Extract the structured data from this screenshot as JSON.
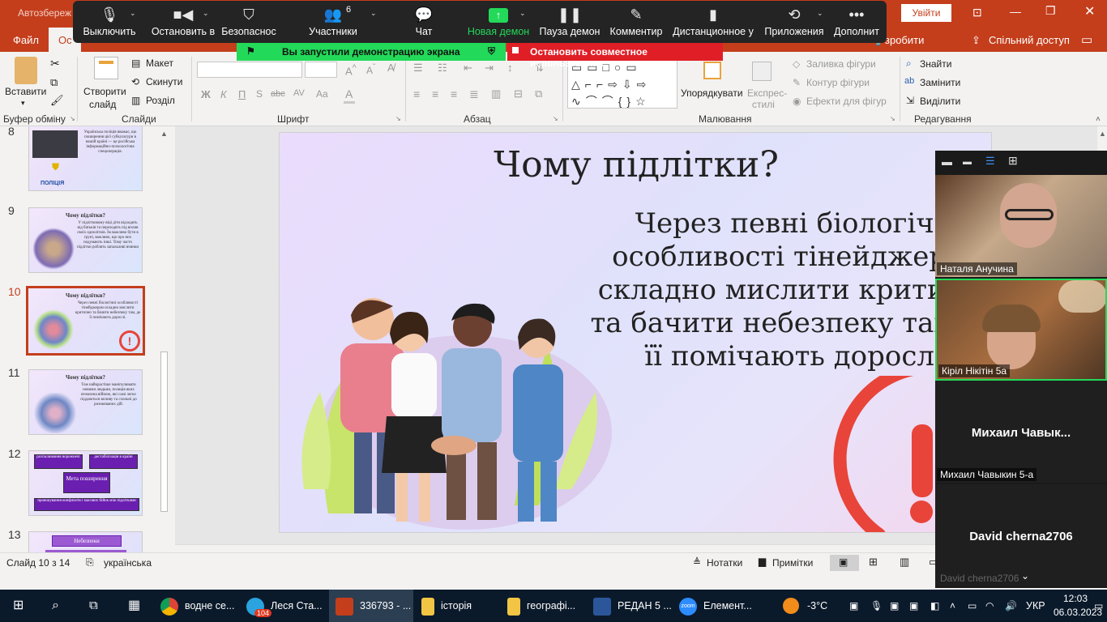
{
  "window": {
    "title": "Автозбереж",
    "signin_label": "Увійти",
    "min_icon": "minimize-icon",
    "max_icon": "restore-icon",
    "close_icon": "close-icon"
  },
  "ribbon_tabs": {
    "file": "Файл",
    "home": "Ос",
    "tell": "зробити",
    "share": "Спільний доступ"
  },
  "zoom": {
    "mute": "Выключить",
    "video": "Остановить в",
    "security": "Безопаснос",
    "participants": "Участники",
    "participants_count": "6",
    "chat": "Чат",
    "share": "Новая демон",
    "pause": "Пауза демон",
    "annotate": "Комментир",
    "remote": "Дистанционное у",
    "apps": "Приложения",
    "more": "Дополнит",
    "sharing_notice": "Вы запустили демонстрацию экрана",
    "stop_share": "Остановить совместное использование"
  },
  "ribbon": {
    "paste": "Вставити",
    "new_slide": "Створити",
    "new_slide2": "слайд",
    "layout": "Макет",
    "reset": "Скинути",
    "section": "Розділ",
    "font_bold": "Ж",
    "font_italic": "К",
    "font_underline": "П",
    "font_strike": "abc",
    "font_spacing": "AV",
    "font_case": "Aa",
    "arrange": "Упорядкувати",
    "quick_styles": "Експрес-",
    "quick_styles2": "стилі",
    "fill": "Заливка фігури",
    "outline": "Контур фігури",
    "effects": "Ефекти для фігур",
    "find": "Знайти",
    "replace": "Замінити",
    "select": "Виділити",
    "groups": {
      "clipboard": "Буфер обміну",
      "slides": "Слайди",
      "font": "Шрифт",
      "paragraph": "Абзац",
      "drawing": "Малювання",
      "editing": "Редагування"
    }
  },
  "thumbs": [
    {
      "num": "8",
      "title": "",
      "text": "Українська поліція вважає, що поширення цієї субкультури в нашій країні — це російська інформаційно-психологічна спецоперація.",
      "badge": "ПОЛІЦІЯ"
    },
    {
      "num": "9",
      "title": "Чому підлітки?",
      "text": "У підлітковому віці діти відходять від батьків та переходять під вплив своїх однолітків. Їм важливо бути в групі, важливо, що про них подумають інші. Тому часто підлітки роблять запальливі вчинки"
    },
    {
      "num": "10",
      "title": "Чому підлітки?",
      "text": "Через певні біологічні особливості тінейджерам складно мислити критично та бачити небезпеку там, де її помічають дорослі."
    },
    {
      "num": "11",
      "title": "Чому підлітки?",
      "text": "Тож найкрастіше маніпулювати новими людьми, позиція яких втомлена війною, які самі легко піддаються впливу та схильні до ризикованих дій."
    },
    {
      "num": "12",
      "boxes": [
        "розпалювання ворожнечі",
        "дестабілізація в країні",
        "Мета поширення",
        "провокування конфліктів і масових бійок між підлітками"
      ]
    },
    {
      "num": "13",
      "boxes": [
        "Небезпеки"
      ]
    }
  ],
  "slide": {
    "title": "Чому підлітки?",
    "body": [
      "Через певні біологічні",
      "особливості тінейджерам",
      "складно мислити критично",
      "та бачити небезпеку там, де",
      "її помічають дорослі."
    ]
  },
  "status": {
    "slide_counter": "Слайд 10 з 14",
    "language": "українська",
    "notes": "Нотатки",
    "comments": "Примітки"
  },
  "gallery": {
    "p1": "Наталя Анучина",
    "p2": "Кіріл Нікітін 5а",
    "p3_big": "Михаил  Чавык...",
    "p3": "Михаил Чавыкин 5-а",
    "p4_big": "David cherna2706",
    "p4": "David cherna2706"
  },
  "taskbar": {
    "chrome": "водне се...",
    "telegram": "Леся Ста...",
    "telegram_badge": "104",
    "ppt": "336793 - ...",
    "folder1": "історія",
    "folder2": "географі...",
    "word": "РЕДАН 5 ...",
    "zoom": "Елемент...",
    "temp": "-3°C",
    "lang": "УКР",
    "time": "12:03",
    "date": "06.03.2023",
    "zoom_logo": "zoom"
  },
  "colors": {
    "ppt_red": "#c43e1c",
    "zoom_green": "#23d959",
    "zoom_red": "#e01e26",
    "taskbar": "#0b1a2b"
  }
}
